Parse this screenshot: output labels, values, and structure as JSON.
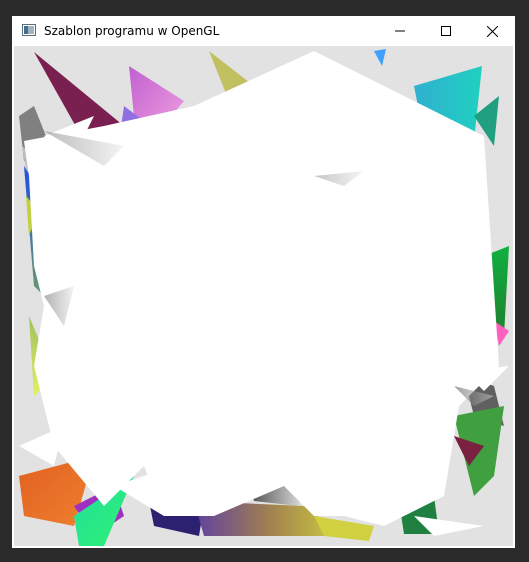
{
  "window": {
    "title": "Szablon programu w OpenGL"
  },
  "controls": {
    "minimize_icon": "minimize-icon",
    "maximize_icon": "maximize-icon",
    "close_icon": "close-icon"
  }
}
